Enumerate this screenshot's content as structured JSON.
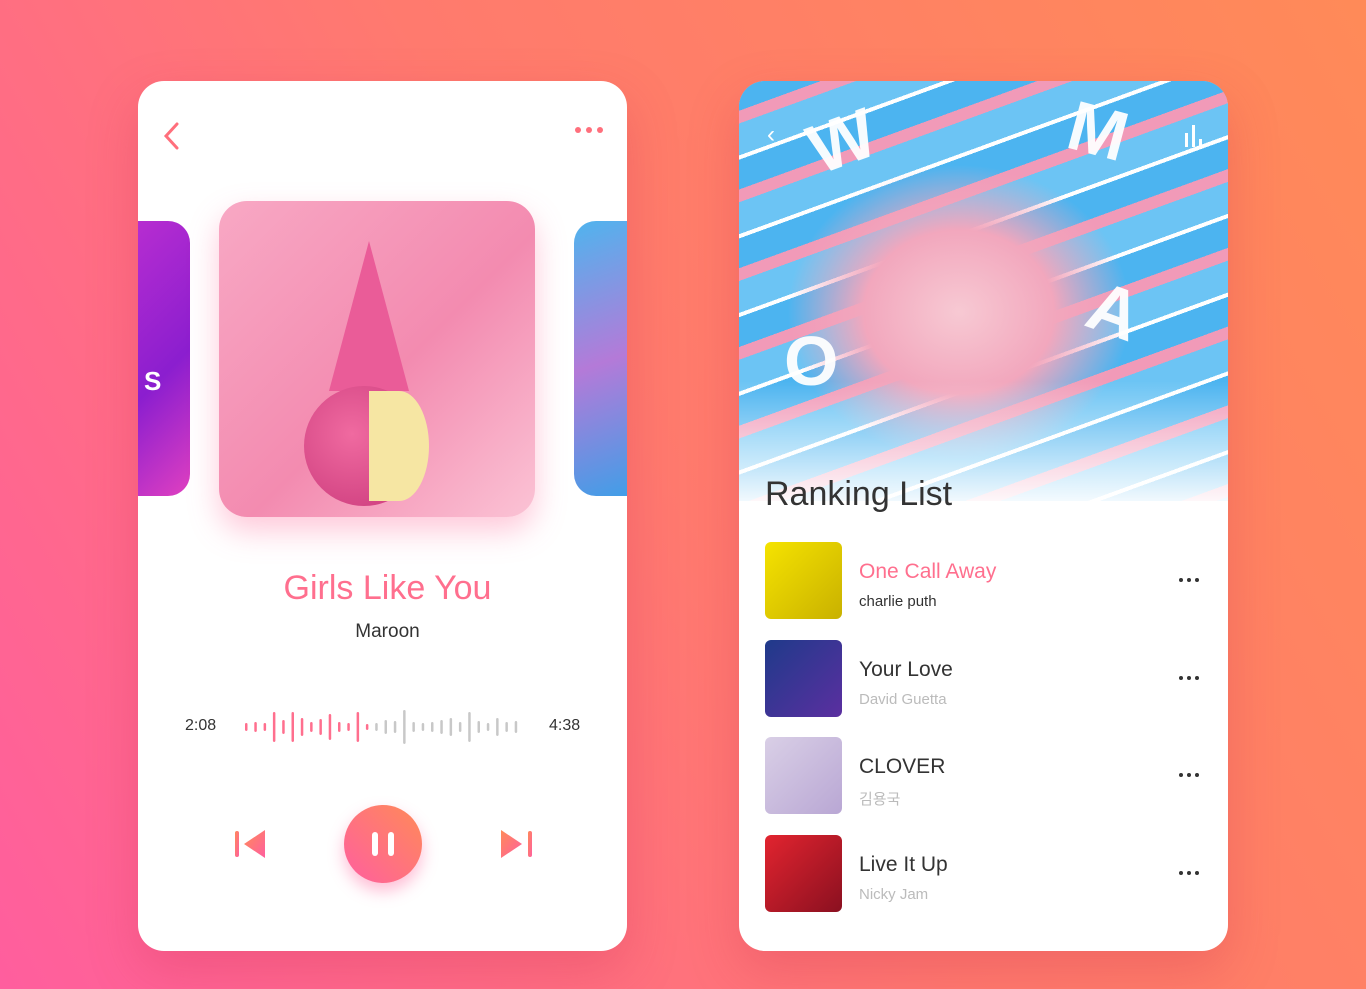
{
  "player": {
    "song_title": "Girls Like You",
    "artist": "Maroon",
    "elapsed": "2:08",
    "duration": "4:38",
    "progress": 0.46,
    "side_left_letter": "S",
    "accent": "#ff6f8e"
  },
  "ranking": {
    "title": "Ranking List",
    "hero_letters": [
      "W",
      "M",
      "O",
      "A"
    ],
    "items": [
      {
        "song": "One Call Away",
        "artist": "charlie puth",
        "active": true,
        "thumb": [
          "#f5e300",
          "#c9b100"
        ]
      },
      {
        "song": "Your Love",
        "artist": "David Guetta",
        "active": false,
        "thumb": [
          "#1f3a8a",
          "#5b2fa0"
        ]
      },
      {
        "song": "CLOVER",
        "artist": "김용국",
        "active": false,
        "thumb": [
          "#d9cfe6",
          "#b9a7d4"
        ]
      },
      {
        "song": "Live It Up",
        "artist": "Nicky Jam",
        "active": false,
        "thumb": [
          "#e2242f",
          "#8a1020"
        ]
      }
    ]
  }
}
